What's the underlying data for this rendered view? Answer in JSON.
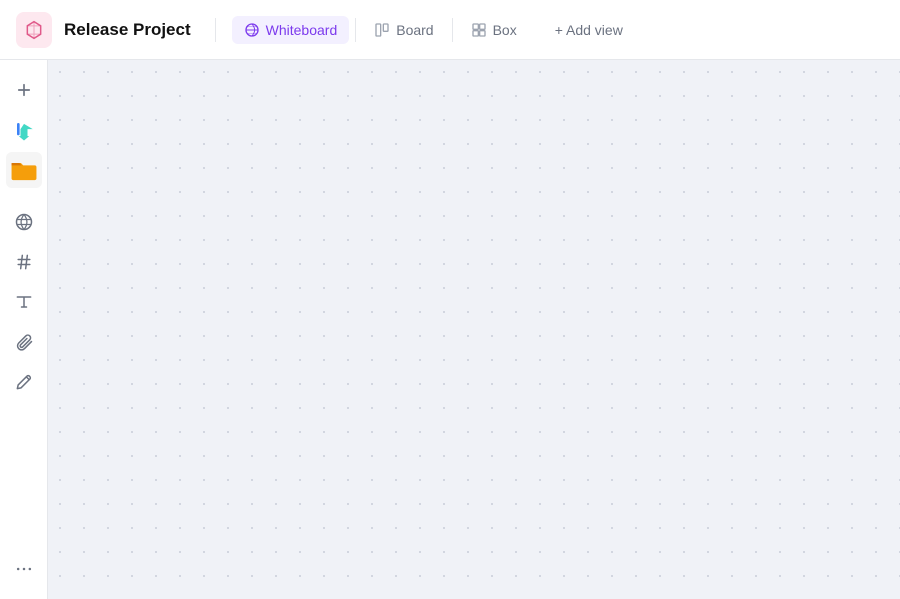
{
  "header": {
    "project_icon_alt": "cube-icon",
    "project_title": "Release Project",
    "tabs": [
      {
        "id": "whiteboard",
        "label": "Whiteboard",
        "active": true,
        "icon": "whiteboard-icon"
      },
      {
        "id": "board",
        "label": "Board",
        "active": false,
        "icon": "board-icon"
      },
      {
        "id": "box",
        "label": "Box",
        "active": false,
        "icon": "box-icon"
      }
    ],
    "add_view_label": "+ Add view"
  },
  "sidebar": {
    "tools": [
      {
        "id": "add",
        "icon": "plus-icon",
        "label": "+"
      },
      {
        "id": "cursor",
        "icon": "cursor-tool-icon",
        "label": "cursor"
      },
      {
        "id": "folder",
        "icon": "folder-icon",
        "label": "folder"
      },
      {
        "id": "globe",
        "icon": "globe-icon",
        "label": "globe"
      },
      {
        "id": "hashtag",
        "icon": "hashtag-icon",
        "label": "#"
      },
      {
        "id": "text",
        "icon": "text-icon",
        "label": "T"
      },
      {
        "id": "attachment",
        "icon": "attachment-icon",
        "label": "attachment"
      },
      {
        "id": "draw",
        "icon": "draw-icon",
        "label": "draw"
      },
      {
        "id": "more",
        "icon": "more-icon",
        "label": "..."
      }
    ]
  },
  "canvas": {
    "background_color": "#f0f2f7"
  }
}
